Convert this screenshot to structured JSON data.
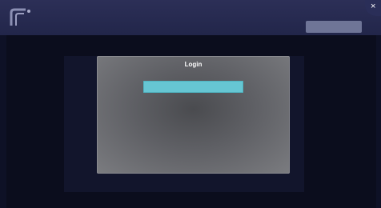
{
  "header": {
    "center_text": "",
    "button_label": "",
    "close_symbol": "×"
  },
  "modal": {
    "title": "Login",
    "primary_button_label": ""
  },
  "colors": {
    "topbar": "#2a2d55",
    "background": "#0e1126",
    "modal": "#6b6c71",
    "primary_button": "#66c6d3"
  },
  "icons": {
    "logo": "app-logo-icon",
    "close": "close-icon"
  }
}
